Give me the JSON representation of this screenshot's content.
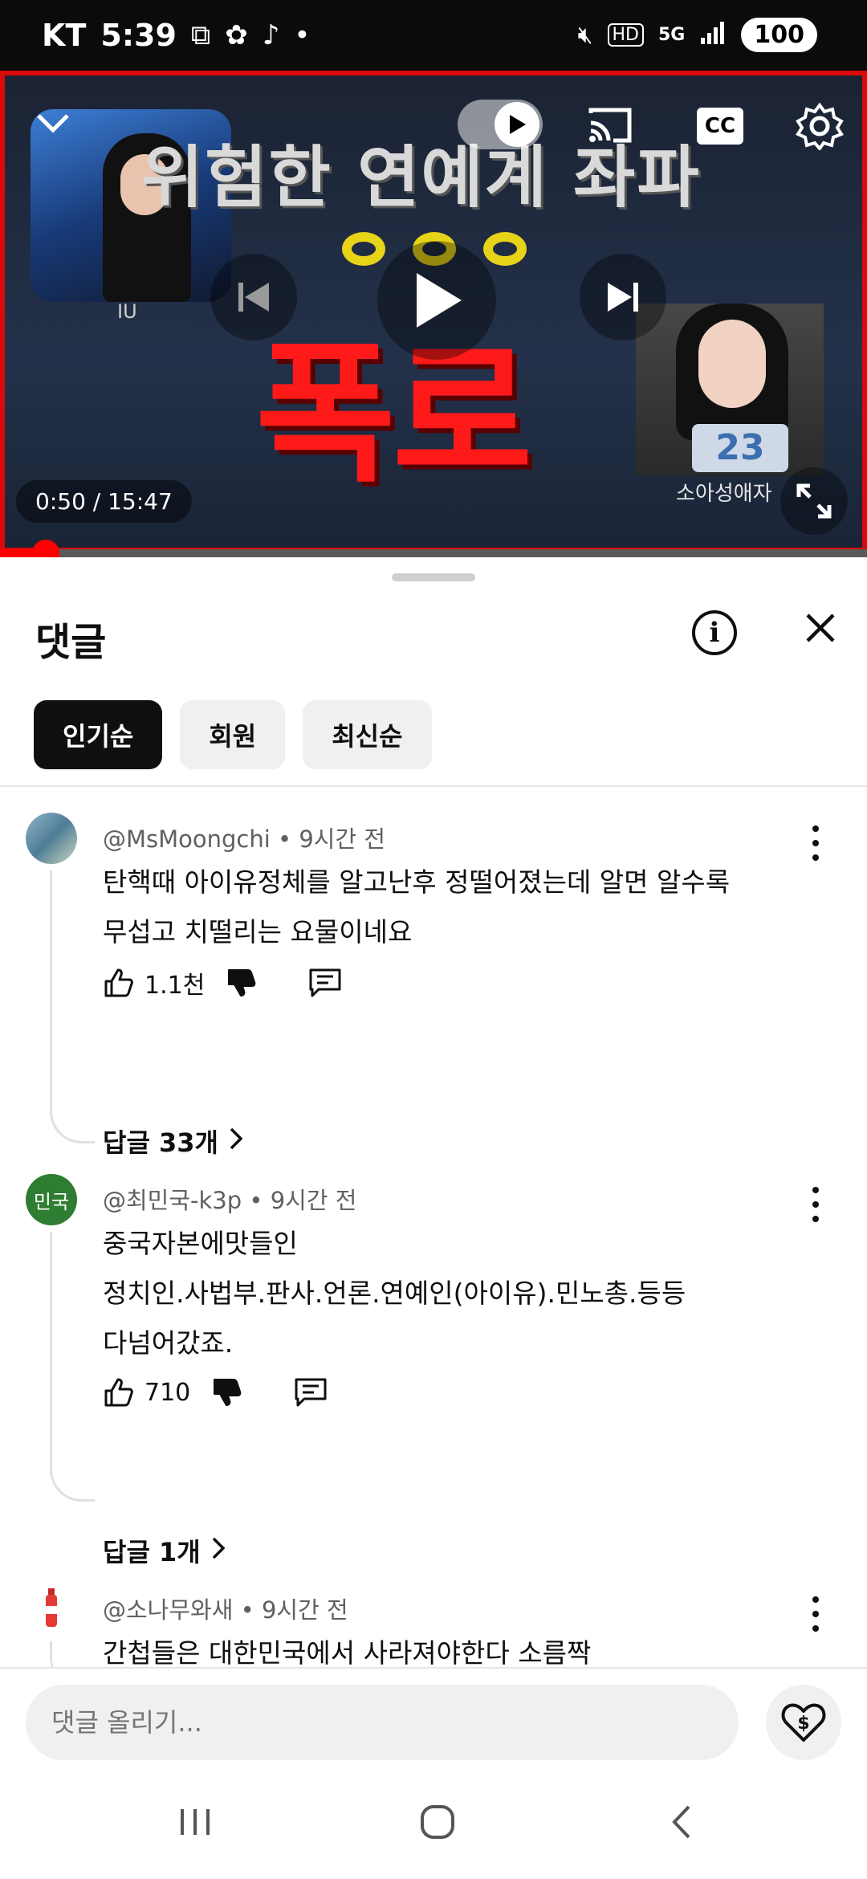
{
  "status_bar": {
    "carrier": "KT",
    "time": "5:39",
    "battery": "100",
    "hd": "HD",
    "network": "5G"
  },
  "player": {
    "thumbnail_title": "위험한 연예계 좌파",
    "thumbnail_headline": "폭로",
    "left_photo_caption": "IU",
    "right_photo_caption": "소아성애자",
    "cake_number": "23",
    "cc_label": "CC",
    "time_display": "0:50 / 15:47",
    "progress_played": 0.0529,
    "progress_buffered": 0.17,
    "progress_color": "#ff0000",
    "border_color": "#d90a0a"
  },
  "comments_panel": {
    "title": "댓글",
    "chips": [
      "인기순",
      "회원",
      "최신순"
    ],
    "active_chip": "인기순",
    "comments": [
      {
        "author": "@MsMoongchi",
        "time": "9시간 전",
        "lines": [
          "탄핵때 아이유정체를 알고난후 정떨어졌는데 알면 알수록",
          "무섭고 치떨리는 요물이네요"
        ],
        "likes": "1.1천",
        "replies": "답글 33개"
      },
      {
        "author": "@최민국-k3p",
        "time": "9시간 전",
        "avatar_text": "민국",
        "avatar_color": "#2e7d32",
        "lines": [
          "중국자본에맛들인",
          "정치인.사법부.판사.언론.연예인(아이유).민노총.등등",
          "다넘어갔죠."
        ],
        "likes": "710",
        "replies": "답글 1개"
      },
      {
        "author": "@소나무와새",
        "time": "9시간 전",
        "lines": [
          "간첩들은 대한민국에서 사라져야한다 소름짝"
        ]
      }
    ]
  },
  "composer": {
    "placeholder": "댓글 올리기..."
  },
  "icons": {
    "like": "thumb-up-icon",
    "dislike": "thumb-down-icon",
    "reply": "comment-icon",
    "more": "more-vert-icon",
    "thanks": "super-thanks-icon"
  }
}
